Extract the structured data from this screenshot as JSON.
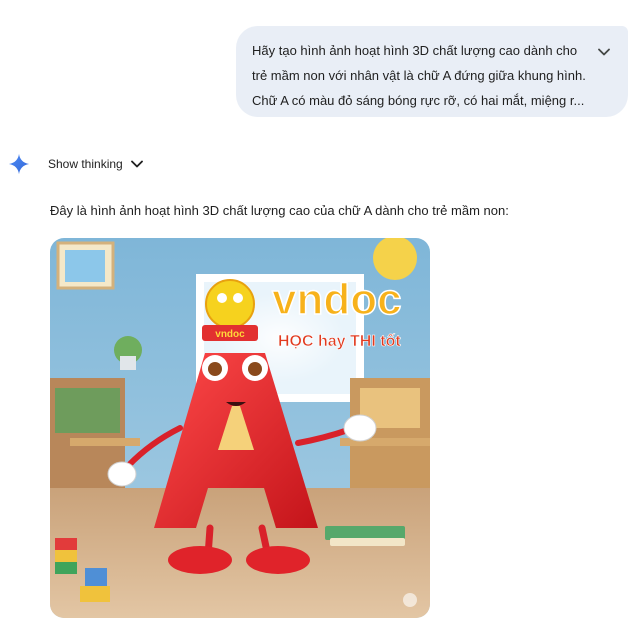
{
  "user_message": {
    "lines": [
      "Hãy tạo hình ảnh hoạt hình 3D chất lượng cao dành cho",
      "trẻ mầm non với nhân vật là chữ A đứng giữa khung hình.",
      "Chữ A có màu đỏ sáng bóng rực rỡ, có hai mắt, miệng r..."
    ],
    "expand_icon": "chevron-down-icon"
  },
  "response": {
    "assistant_icon": "sparkle-icon",
    "thinking_label": "Show thinking",
    "text": "Đây là hình ảnh hoạt hình 3D chất lượng cao của chữ A dành cho trẻ mầm non:",
    "image": {
      "letter": "A",
      "watermark_brand": "vndoc",
      "watermark_slogan": "HỌC hay THI tốt"
    }
  },
  "colors": {
    "bubble_bg": "#e9eef6",
    "accent_blue": "#4285f4",
    "letter_red": "#e3262b"
  }
}
